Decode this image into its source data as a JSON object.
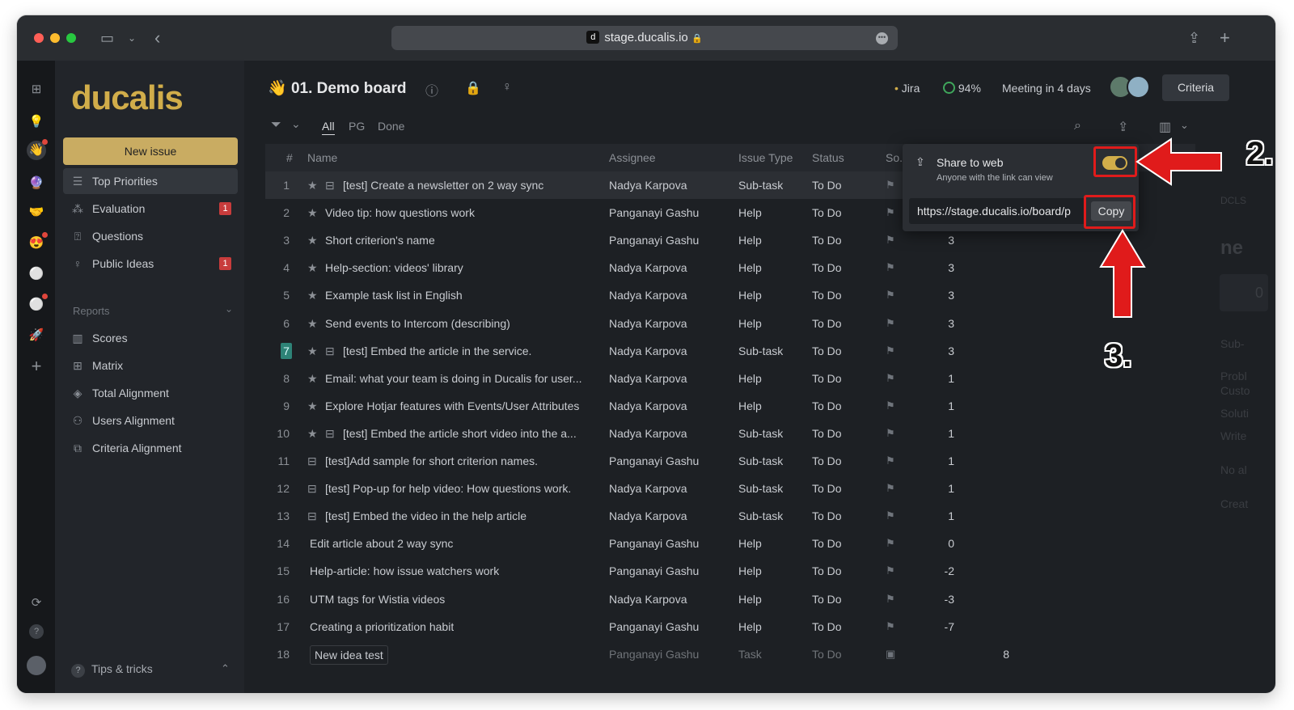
{
  "browser": {
    "url": "stage.ducalis.io",
    "favicon": "d"
  },
  "sidebar": {
    "logo": "ducalis",
    "new_issue": "New issue",
    "items": [
      {
        "label": "Top Priorities",
        "icon": "list-icon"
      },
      {
        "label": "Evaluation",
        "icon": "evaluation-icon",
        "badge": "1"
      },
      {
        "label": "Questions",
        "icon": "questions-icon"
      },
      {
        "label": "Public Ideas",
        "icon": "bulb-icon",
        "badge": "1"
      }
    ],
    "reports_header": "Reports",
    "reports": [
      {
        "label": "Scores",
        "icon": "columns-icon"
      },
      {
        "label": "Matrix",
        "icon": "matrix-icon"
      },
      {
        "label": "Total Alignment",
        "icon": "layers-icon"
      },
      {
        "label": "Users Alignment",
        "icon": "users-icon"
      },
      {
        "label": "Criteria Alignment",
        "icon": "criteria-icon"
      }
    ],
    "tips": "Tips & tricks"
  },
  "header": {
    "board_emoji": "👋",
    "board_title": "01. Demo board",
    "jira": "Jira",
    "progress": "94%",
    "meeting": "Meeting in 4 days",
    "criteria": "Criteria"
  },
  "filters": [
    "All",
    "PG",
    "Done"
  ],
  "table": {
    "columns": [
      "#",
      "Name",
      "Assignee",
      "Issue Type",
      "Status",
      "So..."
    ],
    "rows": [
      {
        "n": "1",
        "name": "[test] Create a newsletter on 2 way sync",
        "star": true,
        "sub": true,
        "assignee": "Nadya Karpova",
        "type": "Sub-task",
        "status": "To Do",
        "score": ""
      },
      {
        "n": "2",
        "name": "Video tip: how questions work",
        "star": true,
        "sub": false,
        "assignee": "Panganayi Gashu",
        "type": "Help",
        "status": "To Do",
        "score": ""
      },
      {
        "n": "3",
        "name": "Short criterion's name",
        "star": true,
        "sub": false,
        "assignee": "Panganayi Gashu",
        "type": "Help",
        "status": "To Do",
        "score": "3"
      },
      {
        "n": "4",
        "name": "Help-section: videos' library",
        "star": true,
        "sub": false,
        "assignee": "Nadya Karpova",
        "type": "Help",
        "status": "To Do",
        "score": "3"
      },
      {
        "n": "5",
        "name": "Example task list in English",
        "star": true,
        "sub": false,
        "assignee": "Nadya Karpova",
        "type": "Help",
        "status": "To Do",
        "score": "3"
      },
      {
        "n": "6",
        "name": "Send events to Intercom (describing)",
        "star": true,
        "sub": false,
        "assignee": "Nadya Karpova",
        "type": "Help",
        "status": "To Do",
        "score": "3"
      },
      {
        "n": "7",
        "name": "[test] Embed the article in the service.",
        "star": true,
        "sub": true,
        "assignee": "Nadya Karpova",
        "type": "Sub-task",
        "status": "To Do",
        "score": "3"
      },
      {
        "n": "8",
        "name": "Email: what your team is doing in Ducalis for user...",
        "star": true,
        "sub": false,
        "assignee": "Nadya Karpova",
        "type": "Help",
        "status": "To Do",
        "score": "1"
      },
      {
        "n": "9",
        "name": "Explore Hotjar features with Events/User Attributes",
        "star": true,
        "sub": false,
        "assignee": "Nadya Karpova",
        "type": "Help",
        "status": "To Do",
        "score": "1"
      },
      {
        "n": "10",
        "name": "[test] Embed the article short video into the a...",
        "star": true,
        "sub": true,
        "assignee": "Nadya Karpova",
        "type": "Sub-task",
        "status": "To Do",
        "score": "1"
      },
      {
        "n": "11",
        "name": "[test]Add sample for short criterion names.",
        "star": false,
        "sub": true,
        "assignee": "Panganayi Gashu",
        "type": "Sub-task",
        "status": "To Do",
        "score": "1"
      },
      {
        "n": "12",
        "name": "[test] Pop-up for help video: How questions work.",
        "star": false,
        "sub": true,
        "assignee": "Nadya Karpova",
        "type": "Sub-task",
        "status": "To Do",
        "score": "1"
      },
      {
        "n": "13",
        "name": "[test] Embed the video in the help article",
        "star": false,
        "sub": true,
        "assignee": "Nadya Karpova",
        "type": "Sub-task",
        "status": "To Do",
        "score": "1"
      },
      {
        "n": "14",
        "name": "Edit article about 2 way sync",
        "star": false,
        "sub": false,
        "assignee": "Panganayi Gashu",
        "type": "Help",
        "status": "To Do",
        "score": "0"
      },
      {
        "n": "15",
        "name": "Help-article: how issue watchers work",
        "star": false,
        "sub": false,
        "assignee": "Panganayi Gashu",
        "type": "Help",
        "status": "To Do",
        "score": "-2"
      },
      {
        "n": "16",
        "name": "UTM tags for Wistia videos",
        "star": false,
        "sub": false,
        "assignee": "Nadya Karpova",
        "type": "Help",
        "status": "To Do",
        "score": "-3"
      },
      {
        "n": "17",
        "name": "Creating a prioritization habit",
        "star": false,
        "sub": false,
        "assignee": "Panganayi Gashu",
        "type": "Help",
        "status": "To Do",
        "score": "-7"
      },
      {
        "n": "18",
        "name": "New idea test",
        "star": false,
        "sub": false,
        "assignee": "Panganayi Gashu",
        "type": "Task",
        "status": "To Do",
        "score": "8"
      }
    ]
  },
  "share": {
    "title": "Share to web",
    "subtitle": "Anyone with the link can view",
    "link": "https://stage.ducalis.io/board/p",
    "copy": "Copy",
    "enabled": true
  },
  "annotations": {
    "step2": "2.",
    "step3": "3."
  },
  "right_panel": {
    "a": "DCLS",
    "b": "ne",
    "c": "0",
    "d": "Sub-",
    "e": "Probl",
    "f": "Custo",
    "g": "Soluti",
    "h": "Write",
    "i": "No al",
    "j": "Creat"
  },
  "colors": {
    "accent": "#d1ad4a",
    "annotation": "#e01b1b",
    "badge": "#c83c3c"
  }
}
